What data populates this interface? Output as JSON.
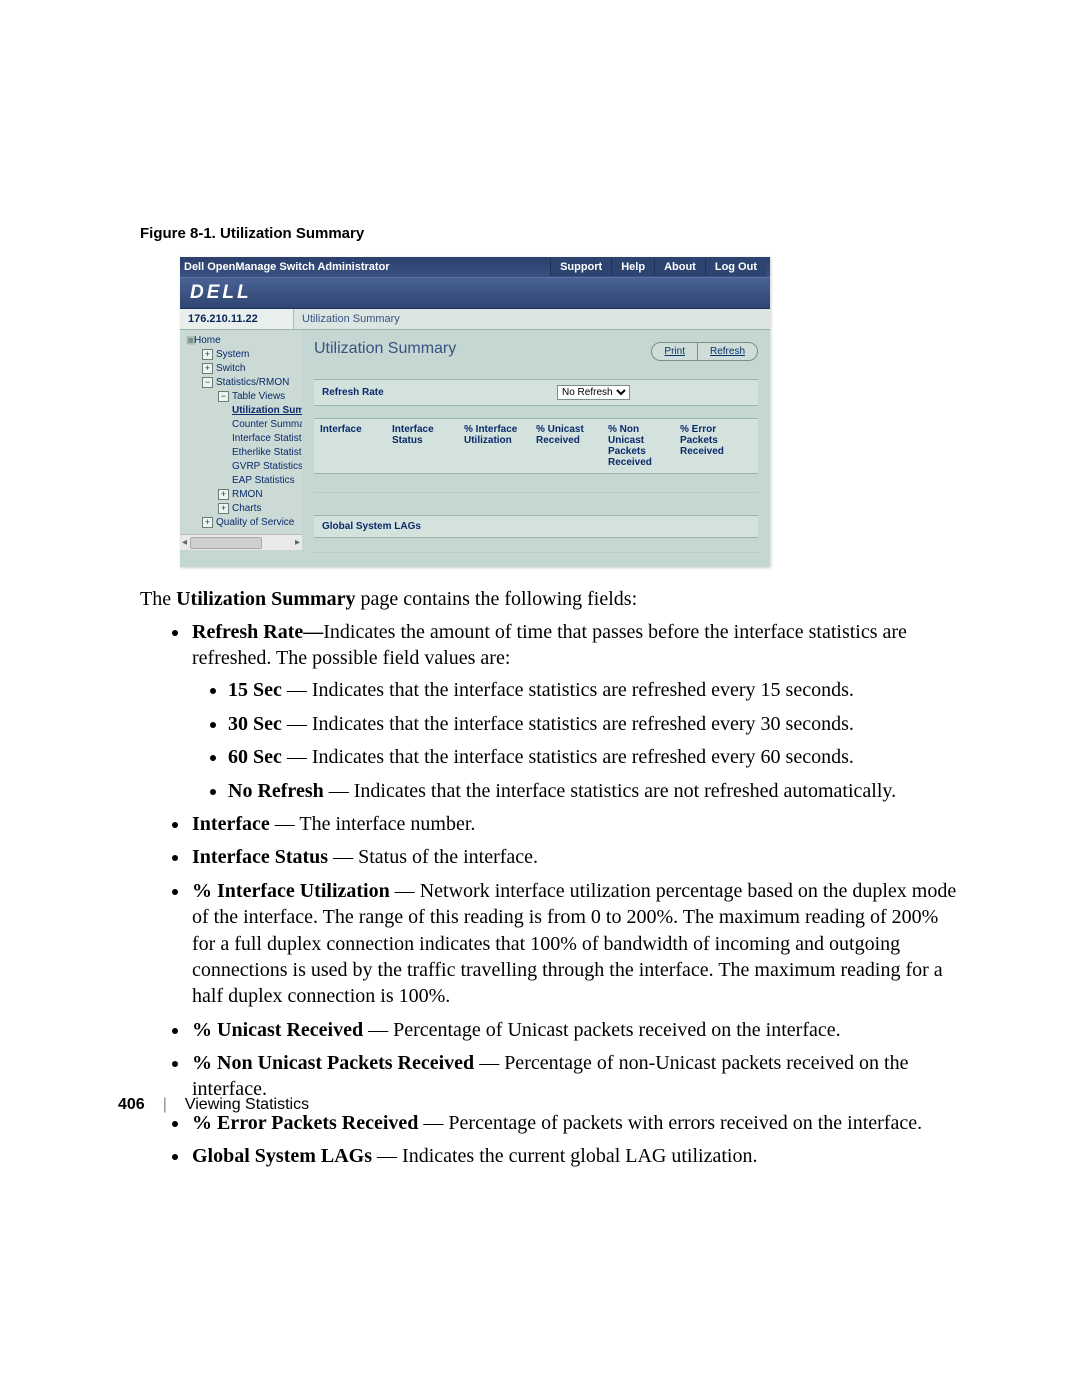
{
  "figure_caption": "Figure 8-1.    Utilization Summary",
  "screenshot": {
    "title": "Dell OpenManage Switch Administrator",
    "top_links": [
      "Support",
      "Help",
      "About",
      "Log Out"
    ],
    "brand": "DELL",
    "ip": "176.210.11.22",
    "breadcrumb": "Utilization Summary",
    "page_heading": "Utilization Summary",
    "buttons": {
      "print": "Print",
      "refresh": "Refresh"
    },
    "refresh_label": "Refresh Rate",
    "refresh_options": [
      "No Refresh"
    ],
    "columns": [
      "Interface",
      "Interface Status",
      "% Interface Utilization",
      "% Unicast Received",
      "% Non Unicast Packets Received",
      "% Error Packets Received"
    ],
    "sublabel": "Global System LAGs",
    "tree": {
      "home": "Home",
      "system": "System",
      "switch": "Switch",
      "stats": "Statistics/RMON",
      "table_views": "Table Views",
      "util": "Utilization Summ",
      "counter": "Counter Summar",
      "ifstat": "Interface Statistic",
      "ether": "Etherlike Statistic",
      "gvrp": "GVRP Statistics",
      "eap": "EAP Statistics",
      "rmon": "RMON",
      "charts": "Charts",
      "qos": "Quality of Service"
    }
  },
  "intro": {
    "pre": "The ",
    "bold": "Utilization Summary",
    "post": " page contains the following fields:"
  },
  "bullets": {
    "refresh": {
      "bold": "Refresh Rate—",
      "text": "Indicates the amount of time that passes before the interface statistics are refreshed. The possible field values are:",
      "subs": {
        "s15": {
          "bold": "15 Sec",
          "text": " — Indicates that the interface statistics are refreshed every 15 seconds."
        },
        "s30": {
          "bold": "30 Sec",
          "text": " — Indicates that the interface statistics are refreshed every 30 seconds."
        },
        "s60": {
          "bold": "60 Sec",
          "text": " — Indicates that the interface statistics are refreshed every 60 seconds."
        },
        "nr": {
          "bold": "No Refresh",
          "text": " — Indicates that the interface statistics are not refreshed automatically."
        }
      }
    },
    "iface": {
      "bold": "Interface",
      "text": " — The interface number."
    },
    "istatus": {
      "bold": "Interface Status",
      "text": " — Status of the interface."
    },
    "iutil": {
      "bold": "% Interface Utilization",
      "text": " — Network interface utilization percentage based on the duplex mode of the interface. The range of this reading is from 0 to 200%. The maximum reading of 200% for a full duplex connection indicates that 100% of bandwidth of incoming and outgoing connections is used by the traffic travelling through the interface. The maximum reading for a half duplex connection is 100%."
    },
    "uni": {
      "bold": "% Unicast Received",
      "text": " — Percentage of Unicast packets received on the interface."
    },
    "nonuni": {
      "bold": "% Non Unicast Packets Received",
      "text": " — Percentage of non-Unicast packets received on the interface."
    },
    "err": {
      "bold": "% Error Packets Received",
      "text": " — Percentage of packets with errors received on the interface."
    },
    "lag": {
      "bold": "Global System LAGs",
      "text": " — Indicates the current global LAG utilization."
    }
  },
  "footer": {
    "page": "406",
    "section": "Viewing Statistics"
  }
}
